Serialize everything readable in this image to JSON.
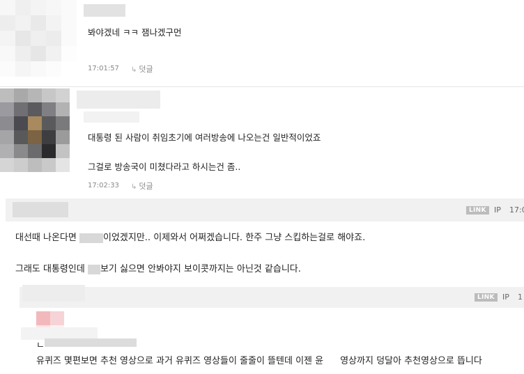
{
  "comments": [
    {
      "text": "봐야겠네 ㅋㅋ 잼나겠구먼",
      "time": "17:01:57",
      "reply_label": "덧글"
    },
    {
      "line1": "대통령 된 사람이 취임초기에 여러방송에 나오는건 일반적이었죠",
      "line2": "그걸로 방송국이 미쳤다라고 하시는건 좀..",
      "time": "17:02:33",
      "reply_label": "덧글"
    },
    {
      "badge": "LINK",
      "ip": "IP",
      "time_partial": "17:0",
      "line1_a": "대선때 나온다면 ",
      "line1_b": "이었겠지만.. 이제와서 어쩌겠습니다. 한주 그냥 스킵하는걸로 해야죠.",
      "line2_a": "그래도 대통령인데 ",
      "line2_b": "보기 싫으면 안봐야지 보이콧까지는 아닌것 같습니다."
    },
    {
      "badge": "LINK",
      "ip": "IP",
      "time_partial": "1",
      "line_partial": "ㄴ",
      "line1_a": "유퀴즈 몇편보면 추천 영상으로 과거 유퀴즈 영상들이 줄줄이 뜰텐데 이젠 윤",
      "line1_b": "영상까지 덩달아 추천영상으로 뜹니다"
    }
  ],
  "colors": {
    "bar_bg": "#f1f1f1",
    "time": "#888888",
    "badge": "#bcbcbc"
  },
  "icons": {
    "reply": "reply-arrow-icon"
  }
}
